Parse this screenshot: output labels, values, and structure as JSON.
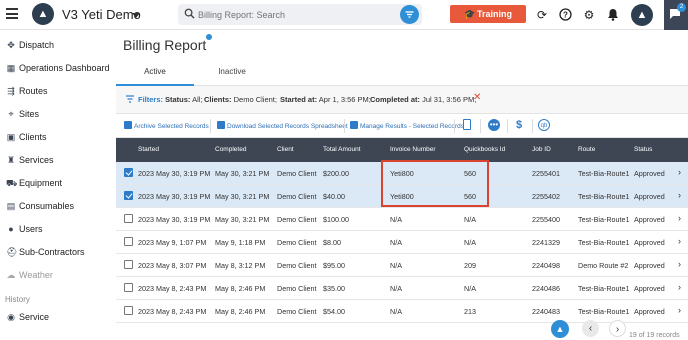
{
  "topbar": {
    "app_title": "V3 Yeti Demo",
    "search_placeholder": "Billing Report: Search",
    "training_label": "Training",
    "chat_badge": "2"
  },
  "sidebar": {
    "items": [
      {
        "label": "Dispatch",
        "icon": "move-arrows-icon"
      },
      {
        "label": "Operations Dashboard",
        "icon": "dashboard-icon"
      },
      {
        "label": "Routes",
        "icon": "routes-icon"
      },
      {
        "label": "Sites",
        "icon": "map-pin-icon"
      },
      {
        "label": "Clients",
        "icon": "address-book-icon"
      },
      {
        "label": "Services",
        "icon": "services-icon"
      },
      {
        "label": "Equipment",
        "icon": "truck-icon"
      },
      {
        "label": "Consumables",
        "icon": "box-icon"
      },
      {
        "label": "Users",
        "icon": "user-icon"
      },
      {
        "label": "Sub-Contractors",
        "icon": "subcontractor-icon"
      },
      {
        "label": "Weather",
        "icon": "cloud-icon"
      }
    ],
    "history_label": "History",
    "history_items": [
      {
        "label": "Service",
        "icon": "service-icon"
      }
    ]
  },
  "page": {
    "title": "Billing Report",
    "tabs": [
      {
        "label": "Active"
      },
      {
        "label": "Inactive"
      }
    ]
  },
  "filters": {
    "label": "Filters:",
    "status_key": "Status:",
    "status_val": "All;",
    "clients_key": "Clients:",
    "clients_val": "Demo Client;",
    "started_key": "Started at:",
    "started_val": "Apr 1, 3:56 PM;",
    "completed_key": "Completed at:",
    "completed_val": "Jul 31, 3:56 PM;"
  },
  "toolbar": {
    "archive": "Archive Selected Records",
    "download": "Download Selected Records Spreadsheet",
    "manage": "Manage Results - Selected Records"
  },
  "table": {
    "headers": [
      "Started",
      "Completed",
      "Client",
      "Total Amount",
      "Invoice Number",
      "Quickbooks Id",
      "Job ID",
      "Route",
      "Status"
    ],
    "rows": [
      {
        "checked": true,
        "started": "2023 May 30, 3:19 PM",
        "completed": "May 30, 3:21 PM",
        "client": "Demo Client",
        "total": "$200.00",
        "invoice": "Yeti800",
        "qb": "560",
        "job": "2255401",
        "route": "Test-Bia-Route1",
        "status": "Approved"
      },
      {
        "checked": true,
        "started": "2023 May 30, 3:19 PM",
        "completed": "May 30, 3:21 PM",
        "client": "Demo Client",
        "total": "$40.00",
        "invoice": "Yeti800",
        "qb": "560",
        "job": "2255402",
        "route": "Test-Bia-Route1",
        "status": "Approved"
      },
      {
        "checked": false,
        "started": "2023 May 30, 3:19 PM",
        "completed": "May 30, 3:21 PM",
        "client": "Demo Client",
        "total": "$100.00",
        "invoice": "N/A",
        "qb": "N/A",
        "job": "2255400",
        "route": "Test-Bia-Route1",
        "status": "Approved"
      },
      {
        "checked": false,
        "started": "2023 May 9, 1:07 PM",
        "completed": "May 9, 1:18 PM",
        "client": "Demo Client",
        "total": "$8.00",
        "invoice": "N/A",
        "qb": "N/A",
        "job": "2241329",
        "route": "Test-Bia-Route1",
        "status": "Approved"
      },
      {
        "checked": false,
        "started": "2023 May 8, 3:07 PM",
        "completed": "May 8, 3:12 PM",
        "client": "Demo Client",
        "total": "$95.00",
        "invoice": "N/A",
        "qb": "209",
        "job": "2240498",
        "route": "Demo Route #2",
        "status": "Approved"
      },
      {
        "checked": false,
        "started": "2023 May 8, 2:43 PM",
        "completed": "May 8, 2:46 PM",
        "client": "Demo Client",
        "total": "$35.00",
        "invoice": "N/A",
        "qb": "N/A",
        "job": "2240486",
        "route": "Test-Bia-Route1",
        "status": "Approved"
      },
      {
        "checked": false,
        "started": "2023 May 8, 2:43 PM",
        "completed": "May 8, 2:46 PM",
        "client": "Demo Client",
        "total": "$54.00",
        "invoice": "N/A",
        "qb": "213",
        "job": "2240483",
        "route": "Test-Bia-Route1",
        "status": "Approved"
      }
    ]
  },
  "footer": {
    "record_count": "19 of 19 records"
  },
  "colors": {
    "accent": "#2e8fd6",
    "training": "#e8583a",
    "header_bg": "#3e4654",
    "selected_row": "#dbe8f6",
    "highlight_box": "#d9432f"
  }
}
